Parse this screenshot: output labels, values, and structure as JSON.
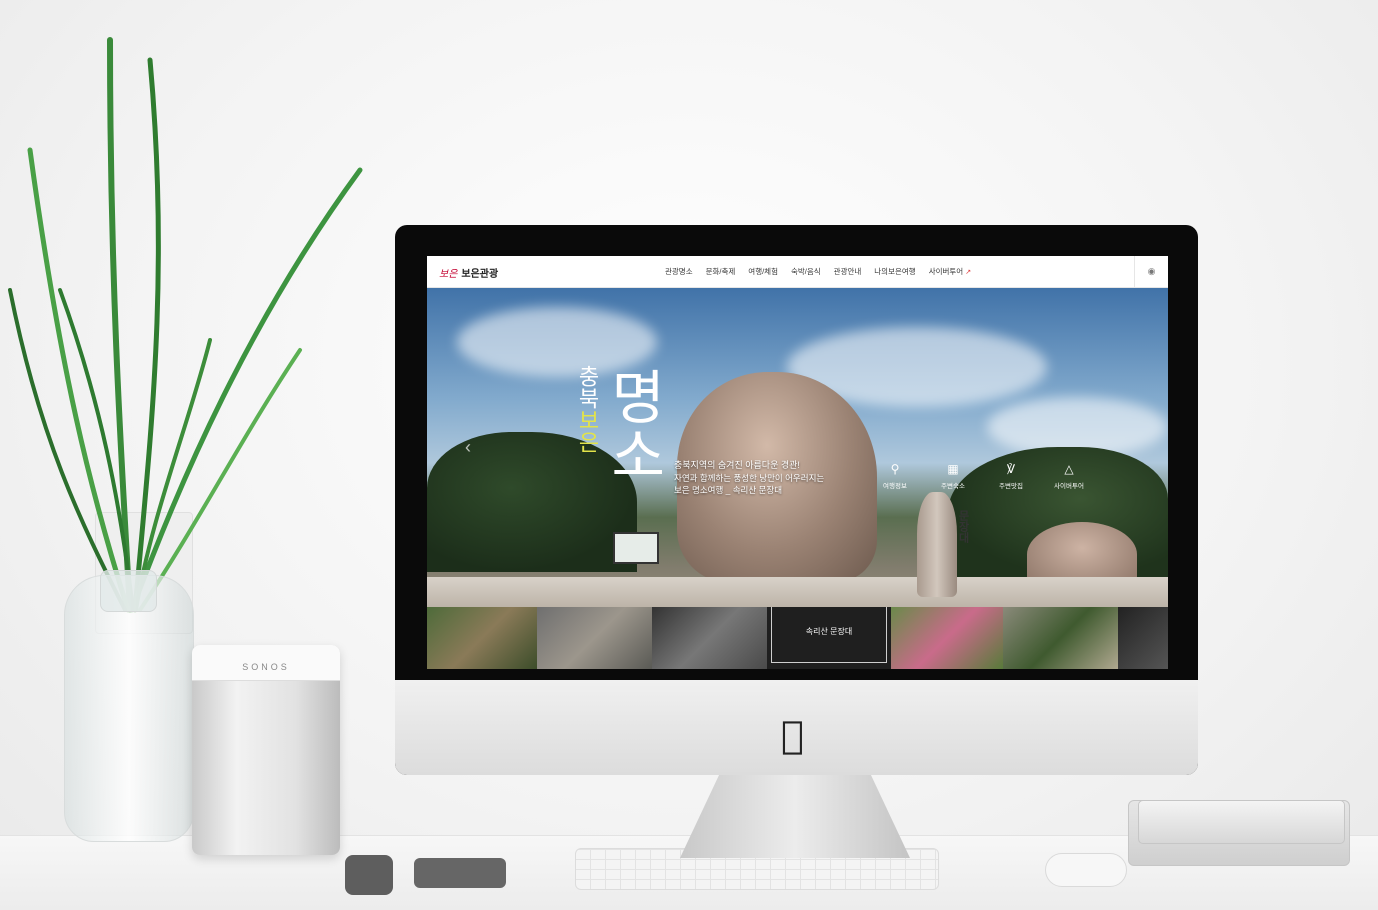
{
  "site": {
    "logo_mark": "보은",
    "logo_text": "보은관광",
    "lang_icon": "globe-icon"
  },
  "nav": {
    "items": [
      {
        "label": "관광명소"
      },
      {
        "label": "문화/축제"
      },
      {
        "label": "여행/체험"
      },
      {
        "label": "숙박/음식"
      },
      {
        "label": "관광안내"
      },
      {
        "label": "나의보은여행"
      },
      {
        "label": "사이버투어",
        "external": true
      }
    ]
  },
  "hero": {
    "region_top": "충북",
    "region_bottom": "보은",
    "title_big": "명소",
    "desc_line1": "충북지역의 숨겨진 아름다운 경관!",
    "desc_line2": "자연과 함께하는 풍성한 낭만이 어우러지는",
    "desc_line3": "보은 명소여행 _ 속리산 문장대",
    "stone_text": "문장대",
    "accent_color": "#e2e34a"
  },
  "quick_links": [
    {
      "label": "여행정보",
      "icon": "map-pin-icon"
    },
    {
      "label": "주변숙소",
      "icon": "building-icon"
    },
    {
      "label": "주변맛집",
      "icon": "fork-knife-icon"
    },
    {
      "label": "사이버투어",
      "icon": "triangle-icon"
    }
  ],
  "thumbnails": {
    "active_label": "속리산 문장대",
    "active_index": 3
  }
}
